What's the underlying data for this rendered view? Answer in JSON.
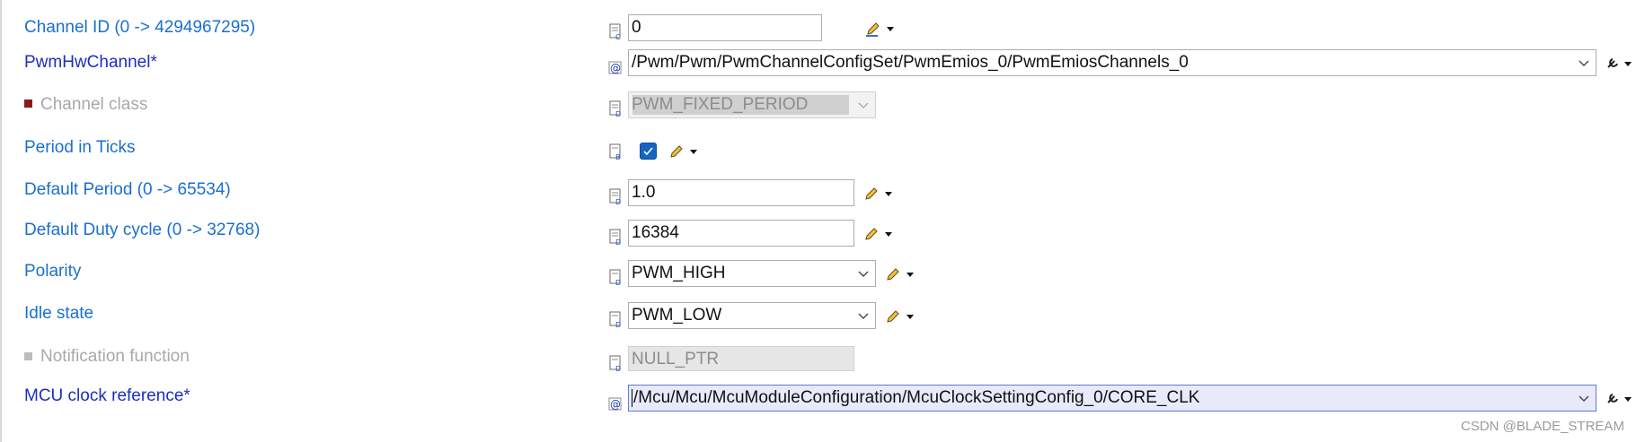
{
  "rows": [
    {
      "label": "Channel ID (0 -> 4294967295)",
      "value": "0"
    },
    {
      "label": "PwmHwChannel*",
      "value": "/Pwm/Pwm/PwmChannelConfigSet/PwmEmios_0/PwmEmiosChannels_0"
    },
    {
      "label": "Channel class",
      "value": "PWM_FIXED_PERIOD"
    },
    {
      "label": "Period in Ticks",
      "checked": true
    },
    {
      "label": "Default Period (0 -> 65534)",
      "value": "1.0"
    },
    {
      "label": "Default Duty cycle (0 -> 32768)",
      "value": "16384"
    },
    {
      "label": "Polarity",
      "value": "PWM_HIGH"
    },
    {
      "label": "Idle state",
      "value": "PWM_LOW"
    },
    {
      "label": "Notification function",
      "value": "NULL_PTR"
    },
    {
      "label": "MCU clock reference*",
      "value": "/Mcu/Mcu/McuModuleConfiguration/McuClockSettingConfig_0/CORE_CLK"
    }
  ],
  "watermark": "CSDN @BLADE_STREAM",
  "icons": {
    "field_icon": "parameter-doc-icon",
    "reference_icon": "reference-at-icon",
    "edit_icon": "pencil-icon",
    "menu_icon": "dropdown-triangle-icon",
    "reference_tool_icon": "reference-wrench-icon"
  },
  "colors": {
    "label": "#1a6fcf",
    "required_label": "#1a2fbf",
    "disabled_label": "#a8a8a8",
    "checkbox": "#1565c0",
    "selected_field": "#e8eafc"
  }
}
